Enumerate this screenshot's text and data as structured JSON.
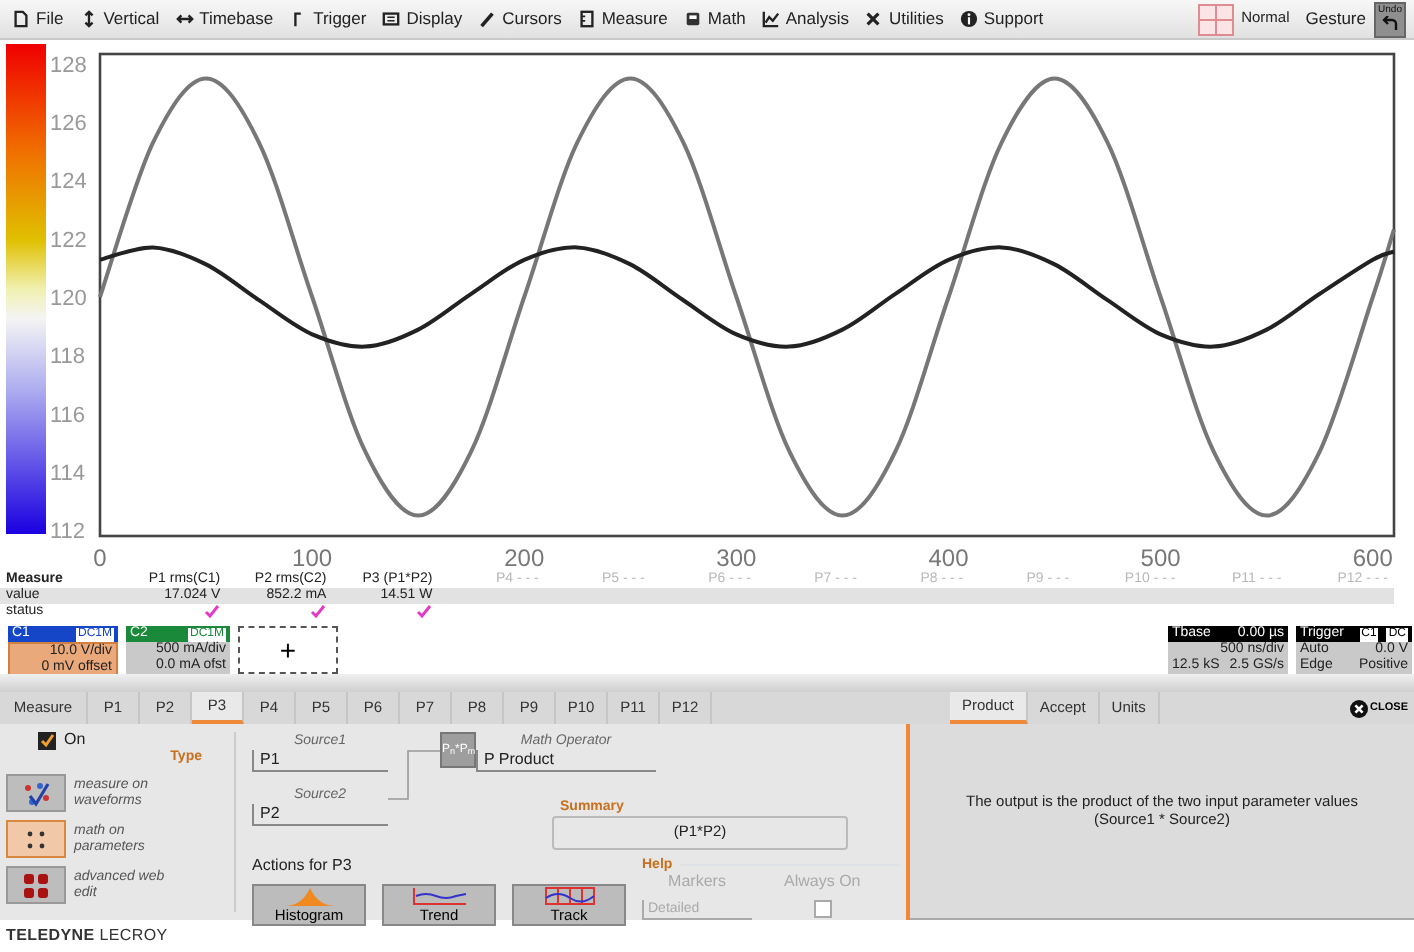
{
  "menu": [
    {
      "label": "File"
    },
    {
      "label": "Vertical"
    },
    {
      "label": "Timebase"
    },
    {
      "label": "Trigger"
    },
    {
      "label": "Display"
    },
    {
      "label": "Cursors"
    },
    {
      "label": "Measure"
    },
    {
      "label": "Math"
    },
    {
      "label": "Analysis"
    },
    {
      "label": "Utilities"
    },
    {
      "label": "Support"
    }
  ],
  "display_mode": {
    "label": "Normal"
  },
  "gesture": {
    "label": "Gesture"
  },
  "undo": {
    "label": "Undo"
  },
  "plot": {
    "chart_data": {
      "type": "line",
      "x": [
        0,
        25,
        50,
        75,
        100,
        125,
        150,
        175,
        200,
        225,
        250,
        275,
        300,
        325,
        350,
        375,
        400,
        425,
        450,
        475,
        500,
        525,
        550,
        575,
        600,
        610
      ],
      "series": [
        {
          "color": "#777777",
          "values": [
            120,
            125.3,
            127.5,
            125.3,
            120,
            114.7,
            112.5,
            114.7,
            120,
            125.3,
            127.5,
            125.3,
            120,
            114.7,
            112.5,
            114.7,
            120,
            125.3,
            127.5,
            125.3,
            120,
            114.7,
            112.5,
            114.7,
            120,
            122.32
          ]
        },
        {
          "color": "#222222",
          "values": [
            121.28,
            121.7,
            121.12,
            119.89,
            118.72,
            118.3,
            118.88,
            120.11,
            121.28,
            121.7,
            121.12,
            119.89,
            118.72,
            118.3,
            118.88,
            120.11,
            121.28,
            121.7,
            121.12,
            119.89,
            118.72,
            118.3,
            118.88,
            120.11,
            121.28,
            121.56
          ]
        }
      ],
      "xlim": [
        0,
        610
      ],
      "ylim": [
        111.8,
        128.34
      ],
      "xticks": [
        0,
        100,
        200,
        300,
        400,
        500,
        600
      ],
      "yticks": [
        112,
        114,
        116,
        118,
        120,
        122,
        124,
        126,
        128
      ]
    }
  },
  "measure_table": {
    "row_labels": [
      "Measure",
      "value",
      "status"
    ],
    "params": [
      {
        "header": "P1 rms(C1)",
        "value": "17.024 V",
        "active": true,
        "status_ok": true
      },
      {
        "header": "P2 rms(C2)",
        "value": "852.2 mA",
        "active": true,
        "status_ok": true
      },
      {
        "header": "P3 (P1*P2)",
        "value": "14.51 W",
        "active": true,
        "status_ok": true
      },
      {
        "header": "P4 - - -",
        "active": false,
        "status_ok": false
      },
      {
        "header": "P5 - - -",
        "active": false,
        "status_ok": false
      },
      {
        "header": "P6 - - -",
        "active": false,
        "status_ok": false
      },
      {
        "header": "P7 - - -",
        "active": false,
        "status_ok": false
      },
      {
        "header": "P8 - - -",
        "active": false,
        "status_ok": false
      },
      {
        "header": "P9 - - -",
        "active": false,
        "status_ok": false
      },
      {
        "header": "P10 - - -",
        "active": false,
        "status_ok": false
      },
      {
        "header": "P11 - - -",
        "active": false,
        "status_ok": false
      },
      {
        "header": "P12 - - -",
        "active": false,
        "status_ok": false
      }
    ]
  },
  "channels": [
    {
      "name": "C1",
      "coupling": "DC1M",
      "color": "#1646c8",
      "scale": "10.0 V/div",
      "offset": "0 mV offset",
      "selected": true
    },
    {
      "name": "C2",
      "coupling": "DC1M",
      "color": "#1a8a3a",
      "scale": "500 mA/div",
      "offset": "0.0 mA ofst",
      "selected": false
    }
  ],
  "add_channel": {
    "label": "+"
  },
  "timebase": {
    "title": "Tbase",
    "delay": "0.00 µs",
    "scale": "500 ns/div",
    "samples": "12.5 kS",
    "rate": "2.5 GS/s"
  },
  "trigger": {
    "title": "Trigger",
    "source": "C1",
    "coupling": "DC",
    "mode": "Auto",
    "threshold": "0.0 V",
    "type": "Edge",
    "slope": "Positive"
  },
  "tabs": [
    {
      "label": "Measure",
      "selected": false
    },
    {
      "label": "P1",
      "selected": false
    },
    {
      "label": "P2",
      "selected": false
    },
    {
      "label": "P3",
      "selected": true
    },
    {
      "label": "P4",
      "selected": false
    },
    {
      "label": "P5",
      "selected": false
    },
    {
      "label": "P6",
      "selected": false
    },
    {
      "label": "P7",
      "selected": false
    },
    {
      "label": "P8",
      "selected": false
    },
    {
      "label": "P9",
      "selected": false
    },
    {
      "label": "P10",
      "selected": false
    },
    {
      "label": "P11",
      "selected": false
    },
    {
      "label": "P12",
      "selected": false
    }
  ],
  "right_tabs": [
    {
      "label": "Product",
      "selected": true
    },
    {
      "label": "Accept",
      "selected": false
    },
    {
      "label": "Units",
      "selected": false
    }
  ],
  "close": {
    "label": "CLOSE"
  },
  "setup": {
    "on": {
      "label": "On",
      "checked": true
    },
    "type_title": "Type",
    "types": [
      {
        "label": "measure on waveforms",
        "selected": false
      },
      {
        "label": "math on parameters",
        "selected": true
      },
      {
        "label": "advanced web edit",
        "selected": false
      }
    ],
    "source1": {
      "label": "Source1",
      "value": "P1"
    },
    "source2": {
      "label": "Source2",
      "value": "P2"
    },
    "operator": {
      "label": "Math Operator",
      "value": "P Product",
      "icon_text": "P$_{n}$*P$_{m}$"
    },
    "summary": {
      "title": "Summary",
      "value": "(P1*P2)"
    },
    "actions_title": "Actions for P3",
    "actions": [
      {
        "label": "Histogram"
      },
      {
        "label": "Trend"
      },
      {
        "label": "Track"
      }
    ],
    "help": {
      "title": "Help",
      "markers": {
        "label": "Markers",
        "value": "Detailed",
        "disabled": true
      },
      "always_on": {
        "label": "Always On",
        "checked": false,
        "disabled": true
      }
    }
  },
  "description": [
    "The output is the product of the two input parameter values",
    "(Source1 * Source2)"
  ],
  "footer": {
    "logo": "**TELEDYNE** LECROY"
  }
}
